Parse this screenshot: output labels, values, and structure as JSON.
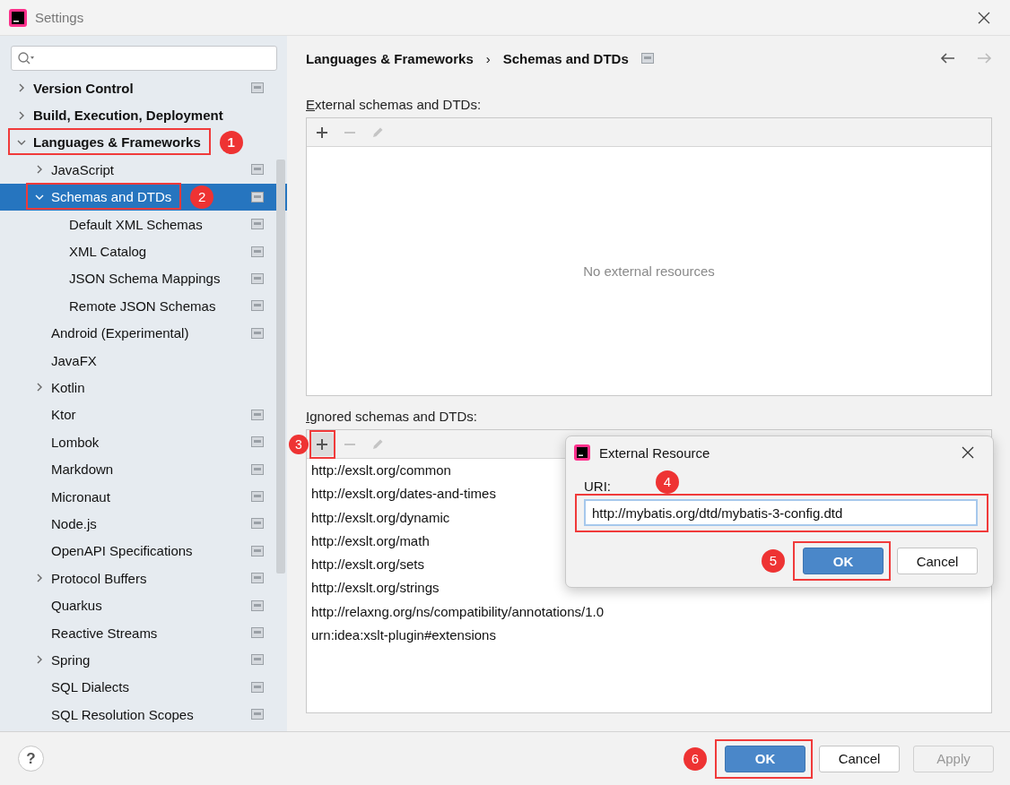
{
  "window": {
    "title": "Settings"
  },
  "sidebar": {
    "items": [
      {
        "label": "Version Control",
        "expanded": false,
        "scope_icon": true
      },
      {
        "label": "Build, Execution, Deployment",
        "expanded": false,
        "scope_icon": false
      },
      {
        "label": "Languages & Frameworks",
        "expanded": true,
        "scope_icon": false,
        "callout": "1",
        "children": [
          {
            "label": "JavaScript",
            "expanded": false,
            "scope_icon": true
          },
          {
            "label": "Schemas and DTDs",
            "expanded": true,
            "scope_icon": true,
            "selected": true,
            "callout": "2",
            "children": [
              {
                "label": "Default XML Schemas",
                "scope_icon": true
              },
              {
                "label": "XML Catalog",
                "scope_icon": true
              },
              {
                "label": "JSON Schema Mappings",
                "scope_icon": true
              },
              {
                "label": "Remote JSON Schemas",
                "scope_icon": true
              }
            ]
          },
          {
            "label": "Android (Experimental)",
            "scope_icon": true
          },
          {
            "label": "JavaFX",
            "scope_icon": false
          },
          {
            "label": "Kotlin",
            "expanded": false,
            "scope_icon": false
          },
          {
            "label": "Ktor",
            "scope_icon": true
          },
          {
            "label": "Lombok",
            "scope_icon": true
          },
          {
            "label": "Markdown",
            "scope_icon": true
          },
          {
            "label": "Micronaut",
            "scope_icon": true
          },
          {
            "label": "Node.js",
            "scope_icon": true
          },
          {
            "label": "OpenAPI Specifications",
            "scope_icon": true
          },
          {
            "label": "Protocol Buffers",
            "expanded": false,
            "scope_icon": true
          },
          {
            "label": "Quarkus",
            "scope_icon": true
          },
          {
            "label": "Reactive Streams",
            "scope_icon": true
          },
          {
            "label": "Spring",
            "expanded": false,
            "scope_icon": true
          },
          {
            "label": "SQL Dialects",
            "scope_icon": true
          },
          {
            "label": "SQL Resolution Scopes",
            "scope_icon": true
          }
        ]
      }
    ]
  },
  "breadcrumb": {
    "items": [
      "Languages & Frameworks",
      "Schemas and DTDs"
    ],
    "separator": "›",
    "scope_icon": true
  },
  "navigation": [
    {
      "kind": "back",
      "disabled": false
    },
    {
      "kind": "forward",
      "disabled": true
    }
  ],
  "sections": [
    {
      "label": "External schemas and DTDs:",
      "toolbar": [
        {
          "kind": "add",
          "disabled": false
        },
        {
          "kind": "remove",
          "disabled": true
        },
        {
          "kind": "edit",
          "disabled": true
        }
      ],
      "empty_text": "No external resources"
    },
    {
      "label": "Ignored schemas and DTDs:",
      "toolbar": [
        {
          "kind": "add",
          "disabled": false,
          "callout": "3"
        },
        {
          "kind": "remove",
          "disabled": true
        },
        {
          "kind": "edit",
          "disabled": true
        }
      ],
      "rows": [
        "http://exslt.org/common",
        "http://exslt.org/dates-and-times",
        "http://exslt.org/dynamic",
        "http://exslt.org/math",
        "http://exslt.org/sets",
        "http://exslt.org/strings",
        "http://relaxng.org/ns/compatibility/annotations/1.0",
        "urn:idea:xslt-plugin#extensions"
      ]
    }
  ],
  "dialog": {
    "title": "External Resource",
    "field_label": "URI:",
    "value": "http://mybatis.org/dtd/mybatis-3-config.dtd",
    "callout": "4",
    "buttons": [
      {
        "label": "OK",
        "default": true,
        "callout": "5"
      },
      {
        "label": "Cancel",
        "default": false
      }
    ]
  },
  "footer": {
    "help": "?",
    "buttons": [
      {
        "label": "OK",
        "default": true,
        "disabled": false,
        "callout": "6"
      },
      {
        "label": "Cancel",
        "default": false,
        "disabled": false
      },
      {
        "label": "Apply",
        "default": false,
        "disabled": true
      }
    ]
  }
}
